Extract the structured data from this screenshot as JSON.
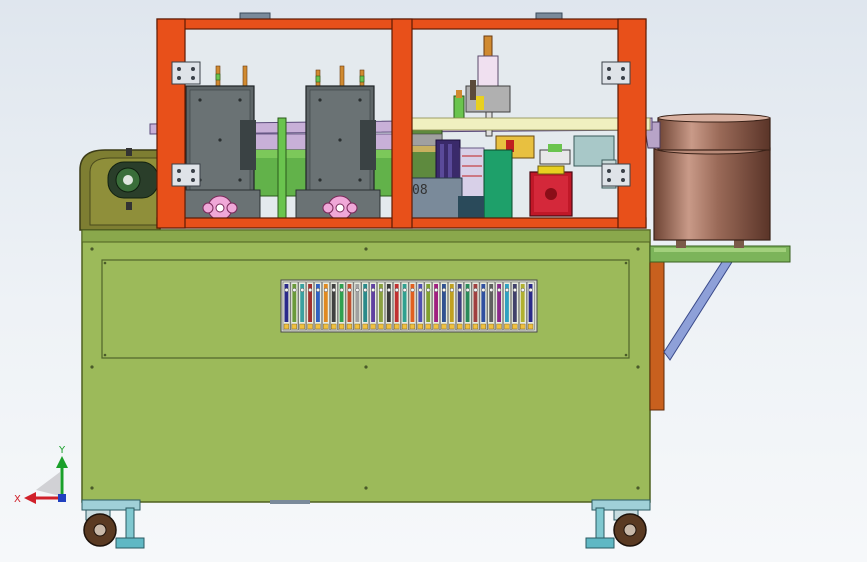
{
  "viewport": {
    "triad": {
      "x_label": "X",
      "y_label": "Y",
      "x_color": "#d0202a",
      "y_color": "#1aa02a",
      "z_color": "#2040c0"
    },
    "part_marking": "08",
    "colors": {
      "frame_orange": "#e8501a",
      "cabinet_green": "#9cba5a",
      "belt_olive": "#7e7e32",
      "feeder_bowl": "#b07a6a",
      "motor_red": "#c01828",
      "wheel_brown": "#5a3a22"
    },
    "terminal_block_colors": [
      "#2a2a8a",
      "#6a9a3a",
      "#3aa0a0",
      "#a03030",
      "#3060c0",
      "#e08a20",
      "#404040",
      "#30a050",
      "#c05030",
      "#a0a0a0",
      "#2a8a8a",
      "#6040a0",
      "#8aa040",
      "#3a3a3a",
      "#c03030",
      "#30a090",
      "#e06020",
      "#5050b0",
      "#80a030",
      "#a02080",
      "#305090",
      "#c0a020",
      "#404080",
      "#2a8a5a",
      "#a04040",
      "#3050a0",
      "#606060",
      "#8a2a8a",
      "#30a0c0",
      "#40406a",
      "#b0b030",
      "#2a2a8a"
    ]
  }
}
